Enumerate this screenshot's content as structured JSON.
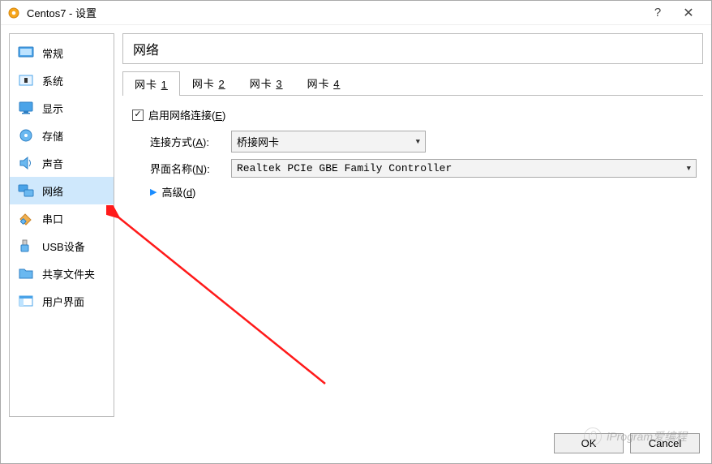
{
  "title": "Centos7 - 设置",
  "sidebar": {
    "items": [
      {
        "label": "常规"
      },
      {
        "label": "系统"
      },
      {
        "label": "显示"
      },
      {
        "label": "存储"
      },
      {
        "label": "声音"
      },
      {
        "label": "网络"
      },
      {
        "label": "串口"
      },
      {
        "label": "USB设备"
      },
      {
        "label": "共享文件夹"
      },
      {
        "label": "用户界面"
      }
    ]
  },
  "main": {
    "header": "网络",
    "tabs": [
      {
        "prefix": "网卡 ",
        "key": "1"
      },
      {
        "prefix": "网卡 ",
        "key": "2"
      },
      {
        "prefix": "网卡 ",
        "key": "3"
      },
      {
        "prefix": "网卡 ",
        "key": "4"
      }
    ],
    "enable_label": "启用网络连接(",
    "enable_key": "E",
    "enable_suffix": ")",
    "attach_label": "连接方式(",
    "attach_key": "A",
    "attach_suffix": "):",
    "attach_value": "桥接网卡",
    "iface_label": "界面名称(",
    "iface_key": "N",
    "iface_suffix": "):",
    "iface_value": "Realtek PCIe GBE Family Controller",
    "advanced_label": "高级(",
    "advanced_key": "d",
    "advanced_suffix": ")"
  },
  "footer": {
    "ok": "OK",
    "cancel": "Cancel"
  },
  "watermark": "iProgram爱编程"
}
